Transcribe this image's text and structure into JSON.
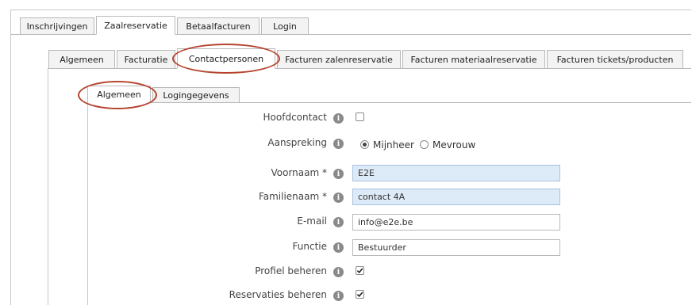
{
  "top_tabs": [
    {
      "label": "Inschrijvingen",
      "active": false
    },
    {
      "label": "Zaalreservatie",
      "active": true
    },
    {
      "label": "Betaalfacturen",
      "active": false
    },
    {
      "label": "Login",
      "active": false
    }
  ],
  "second_tabs": [
    {
      "label": "Algemeen",
      "active": false
    },
    {
      "label": "Facturatie",
      "active": false
    },
    {
      "label": "Contactpersonen",
      "active": true
    },
    {
      "label": "Facturen zalenreservatie",
      "active": false
    },
    {
      "label": "Facturen materiaalreservatie",
      "active": false
    },
    {
      "label": "Facturen tickets/producten",
      "active": false
    }
  ],
  "third_tabs": [
    {
      "label": "Algemeen",
      "active": true
    },
    {
      "label": "Logingegevens",
      "active": false
    }
  ],
  "form": {
    "info_glyph": "i",
    "hoofdcontact": {
      "label": "Hoofdcontact",
      "checked": false
    },
    "aanspreking": {
      "label": "Aanspreking",
      "options": [
        "Mijnheer",
        "Mevrouw"
      ],
      "selected": "Mijnheer"
    },
    "voornaam": {
      "label": "Voornaam *",
      "value": "E2E"
    },
    "familienaam": {
      "label": "Familienaam *",
      "value": "contact 4A"
    },
    "email": {
      "label": "E-mail",
      "value": "info@e2e.be"
    },
    "functie": {
      "label": "Functie",
      "value": "Bestuurder"
    },
    "profiel_beheren": {
      "label": "Profiel beheren",
      "checked": true
    },
    "reservaties_beheren": {
      "label": "Reservaties beheren",
      "checked": true
    }
  },
  "colors": {
    "highlight_ring": "#b5432f",
    "required_field_bg": "#ddeaf7",
    "tab_border": "#b9b9b9"
  }
}
